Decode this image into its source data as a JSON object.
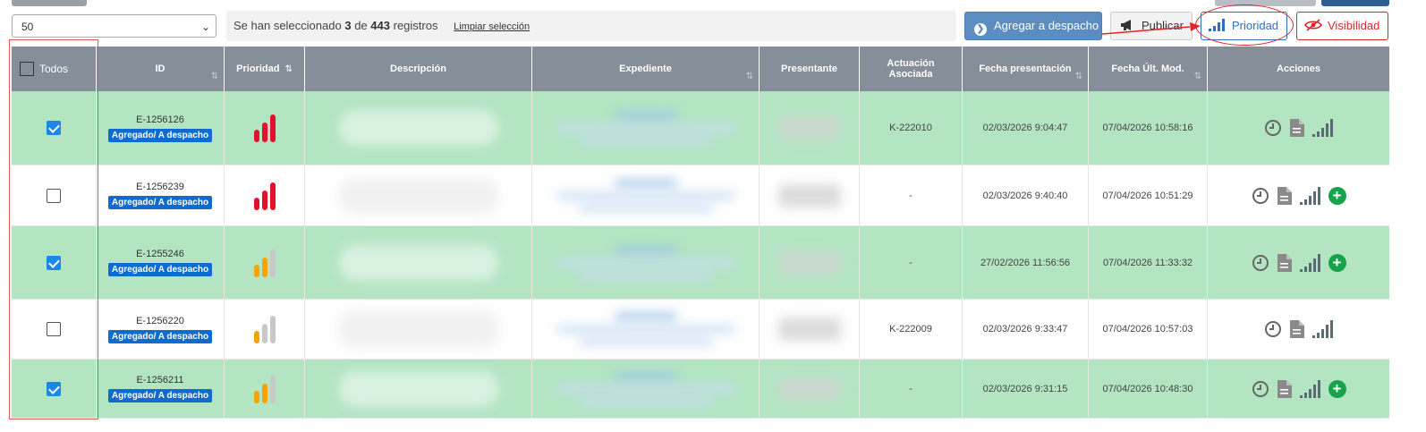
{
  "toolbar": {
    "page_size": "50",
    "selection": {
      "prefix": "Se han seleccionado",
      "selected": "3",
      "of": "de",
      "total": "443",
      "suffix": "registros",
      "clear_label": "Limpiar selección"
    },
    "buttons": {
      "despacho": "Agregar a despacho",
      "publicar": "Publicar",
      "prioridad": "Prioridad",
      "visibilidad": "Visibilidad"
    }
  },
  "colors": {
    "header": "#868e9a",
    "row_green": "#b3e5c3",
    "priority_high": "#e3122c",
    "priority_mid": "#f5a300",
    "bar_off": "#c8c8c8",
    "badge": "#0d6bd1",
    "accent_blue": "#2f6fba",
    "accent_red": "#d9262c"
  },
  "table": {
    "headers": {
      "todos": "Todos",
      "id": "ID",
      "prioridad": "Prioridad",
      "descripcion": "Descripción",
      "expediente": "Expediente",
      "presentante": "Presentante",
      "actuacion_1": "Actuación",
      "actuacion_2": "Asociada",
      "fecha_pres": "Fecha presentación",
      "fecha_mod": "Fecha Últ. Mod.",
      "acciones": "Acciones"
    },
    "rows": [
      {
        "checked": true,
        "id": "E-1256126",
        "badge": "Agregado/ A despacho",
        "priority": "high",
        "actuacion": "K-222010",
        "fecha_pres": "02/03/2026 9:04:47",
        "fecha_mod": "07/04/2026 10:58:16",
        "add_action": false,
        "green": true
      },
      {
        "checked": false,
        "id": "E-1256239",
        "badge": "Agregado/ A despacho",
        "priority": "high",
        "actuacion": "-",
        "fecha_pres": "02/03/2026 9:40:40",
        "fecha_mod": "07/04/2026 10:51:29",
        "add_action": true,
        "green": false
      },
      {
        "checked": true,
        "id": "E-1255246",
        "badge": "Agregado/ A despacho",
        "priority": "medium",
        "actuacion": "-",
        "fecha_pres": "27/02/2026 11:56:56",
        "fecha_mod": "07/04/2026 11:33:32",
        "add_action": true,
        "green": true
      },
      {
        "checked": false,
        "id": "E-1256220",
        "badge": "Agregado/ A despacho",
        "priority": "low",
        "actuacion": "K-222009",
        "fecha_pres": "02/03/2026 9:33:47",
        "fecha_mod": "07/04/2026 10:57:03",
        "add_action": false,
        "green": false
      },
      {
        "checked": true,
        "id": "E-1256211",
        "badge": "Agregado/ A despacho",
        "priority": "medium",
        "actuacion": "-",
        "fecha_pres": "02/03/2026 9:31:15",
        "fecha_mod": "07/04/2026 10:48:30",
        "add_action": true,
        "green": true
      }
    ]
  }
}
